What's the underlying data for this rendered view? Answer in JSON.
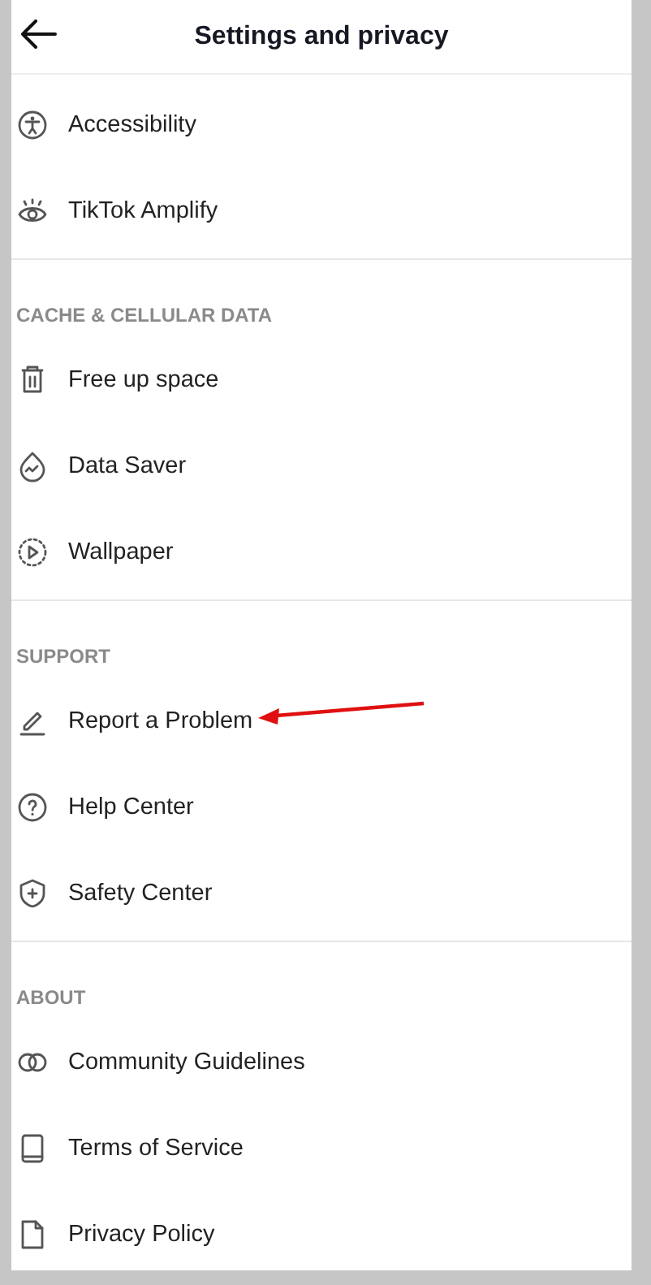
{
  "header": {
    "title": "Settings and privacy"
  },
  "sections": [
    {
      "items": [
        {
          "label": "Accessibility",
          "kind": "accessibility",
          "annotated": false
        },
        {
          "label": "TikTok Amplify",
          "kind": "eye",
          "annotated": false
        }
      ]
    },
    {
      "title": "CACHE & CELLULAR DATA",
      "items": [
        {
          "label": "Free up space",
          "kind": "trash",
          "annotated": false
        },
        {
          "label": "Data Saver",
          "kind": "wave",
          "annotated": false
        },
        {
          "label": "Wallpaper",
          "kind": "play",
          "annotated": false
        }
      ]
    },
    {
      "title": "SUPPORT",
      "items": [
        {
          "label": "Report a Problem",
          "kind": "pencil",
          "annotated": true
        },
        {
          "label": "Help Center",
          "kind": "question",
          "annotated": false
        },
        {
          "label": "Safety Center",
          "kind": "shield",
          "annotated": false
        }
      ]
    },
    {
      "title": "ABOUT",
      "items": [
        {
          "label": "Community Guidelines",
          "kind": "rings",
          "annotated": false
        },
        {
          "label": "Terms of Service",
          "kind": "book",
          "annotated": false
        },
        {
          "label": "Privacy Policy",
          "kind": "page",
          "annotated": false
        }
      ]
    }
  ]
}
